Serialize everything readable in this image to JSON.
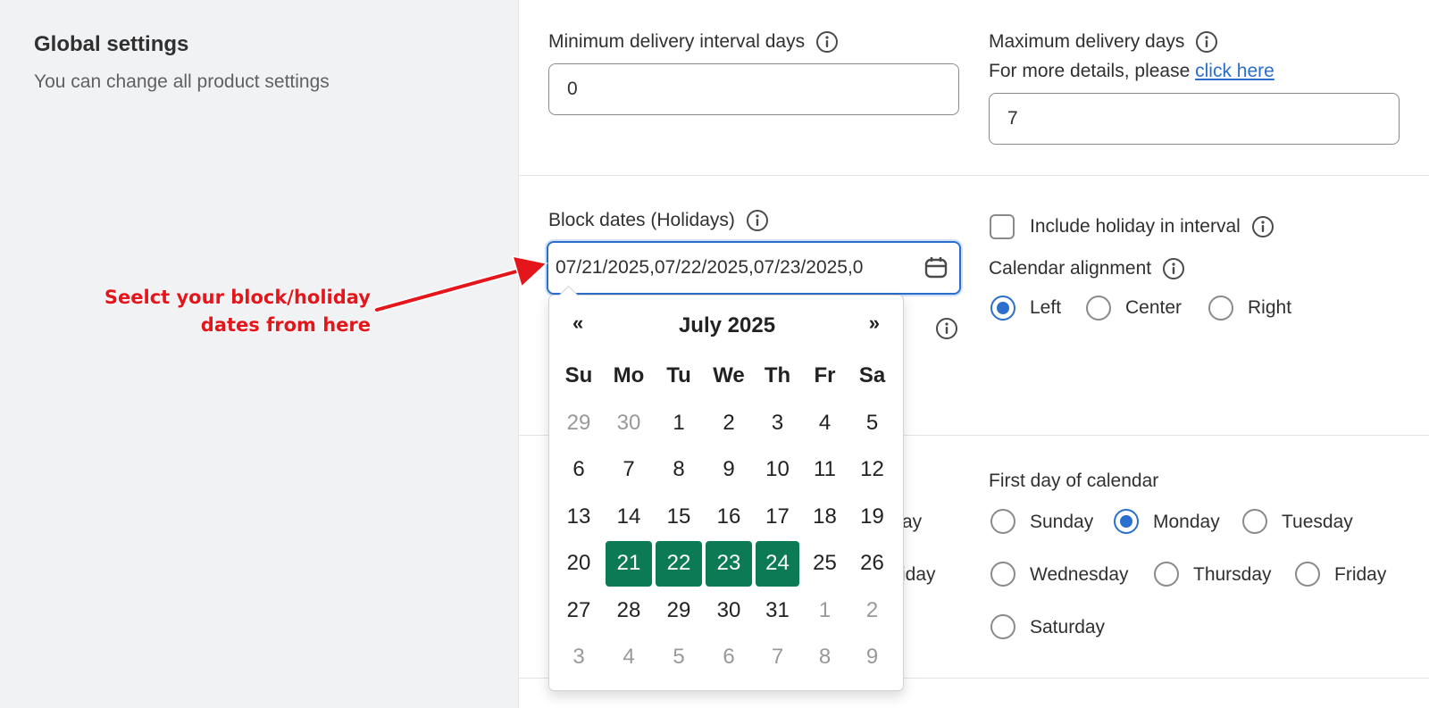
{
  "global": {
    "title": "Global settings",
    "subtitle": "You can change all product settings"
  },
  "delivery": {
    "min_label": "Minimum delivery interval days",
    "min_value": "0",
    "max_label": "Maximum delivery days",
    "details_prefix": "For more details, please ",
    "details_link": "click here",
    "max_value": "7"
  },
  "block_dates": {
    "label": "Block dates (Holidays)",
    "value": "07/21/2025,07/22/2025,07/23/2025,0"
  },
  "include_holiday": {
    "label": "Include holiday in interval",
    "checked": false
  },
  "alignment": {
    "label": "Calendar alignment",
    "options": [
      "Left",
      "Center",
      "Right"
    ],
    "selected": "Left"
  },
  "first_day": {
    "label": "First day of calendar",
    "options": [
      "Sunday",
      "Monday",
      "Tuesday",
      "Wednesday",
      "Thursday",
      "Friday",
      "Saturday"
    ],
    "selected": "Monday"
  },
  "hidden_fragments": {
    "ay": "ay",
    "riday": "riday"
  },
  "datepicker": {
    "prev": "«",
    "next": "»",
    "month_label": "July 2025",
    "weekdays": [
      "Su",
      "Mo",
      "Tu",
      "We",
      "Th",
      "Fr",
      "Sa"
    ],
    "days": [
      {
        "d": "29",
        "muted": true
      },
      {
        "d": "30",
        "muted": true
      },
      {
        "d": "1"
      },
      {
        "d": "2"
      },
      {
        "d": "3"
      },
      {
        "d": "4"
      },
      {
        "d": "5"
      },
      {
        "d": "6"
      },
      {
        "d": "7"
      },
      {
        "d": "8"
      },
      {
        "d": "9"
      },
      {
        "d": "10"
      },
      {
        "d": "11"
      },
      {
        "d": "12"
      },
      {
        "d": "13"
      },
      {
        "d": "14"
      },
      {
        "d": "15"
      },
      {
        "d": "16"
      },
      {
        "d": "17"
      },
      {
        "d": "18"
      },
      {
        "d": "19"
      },
      {
        "d": "20"
      },
      {
        "d": "21",
        "selected": true
      },
      {
        "d": "22",
        "selected": true
      },
      {
        "d": "23",
        "selected": true
      },
      {
        "d": "24",
        "selected": true
      },
      {
        "d": "25"
      },
      {
        "d": "26"
      },
      {
        "d": "27"
      },
      {
        "d": "28"
      },
      {
        "d": "29"
      },
      {
        "d": "30"
      },
      {
        "d": "31"
      },
      {
        "d": "1",
        "muted": true
      },
      {
        "d": "2",
        "muted": true
      },
      {
        "d": "3",
        "muted": true
      },
      {
        "d": "4",
        "muted": true
      },
      {
        "d": "5",
        "muted": true
      },
      {
        "d": "6",
        "muted": true
      },
      {
        "d": "7",
        "muted": true
      },
      {
        "d": "8",
        "muted": true
      },
      {
        "d": "9",
        "muted": true
      }
    ]
  },
  "annotation": {
    "line1": "Seelct your block/holiday",
    "line2": "dates from here"
  },
  "colors": {
    "accent": "#2c6ecb",
    "selected_day": "#0c7a55",
    "annotation": "#e5161b"
  }
}
